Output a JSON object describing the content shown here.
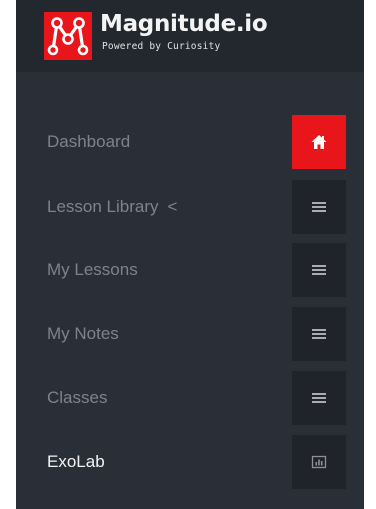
{
  "brand": {
    "name": "Magnitude.io",
    "tagline": "Powered by Curiosity",
    "logo_icon": "molecule-m-logo-icon",
    "accent_color": "#e8151b"
  },
  "sidebar": {
    "background": "#2a2f37",
    "items": [
      {
        "label": "Dashboard",
        "icon": "home-icon",
        "active_icon": true
      },
      {
        "label": "Lesson Library",
        "suffix": "<",
        "icon": "menu-lines-icon"
      },
      {
        "label": "My Lessons",
        "icon": "menu-lines-icon"
      },
      {
        "label": "My Notes",
        "icon": "menu-lines-icon"
      },
      {
        "label": "Classes",
        "icon": "menu-lines-icon"
      },
      {
        "label": "ExoLab",
        "icon": "bar-chart-icon",
        "selected": true
      }
    ]
  }
}
